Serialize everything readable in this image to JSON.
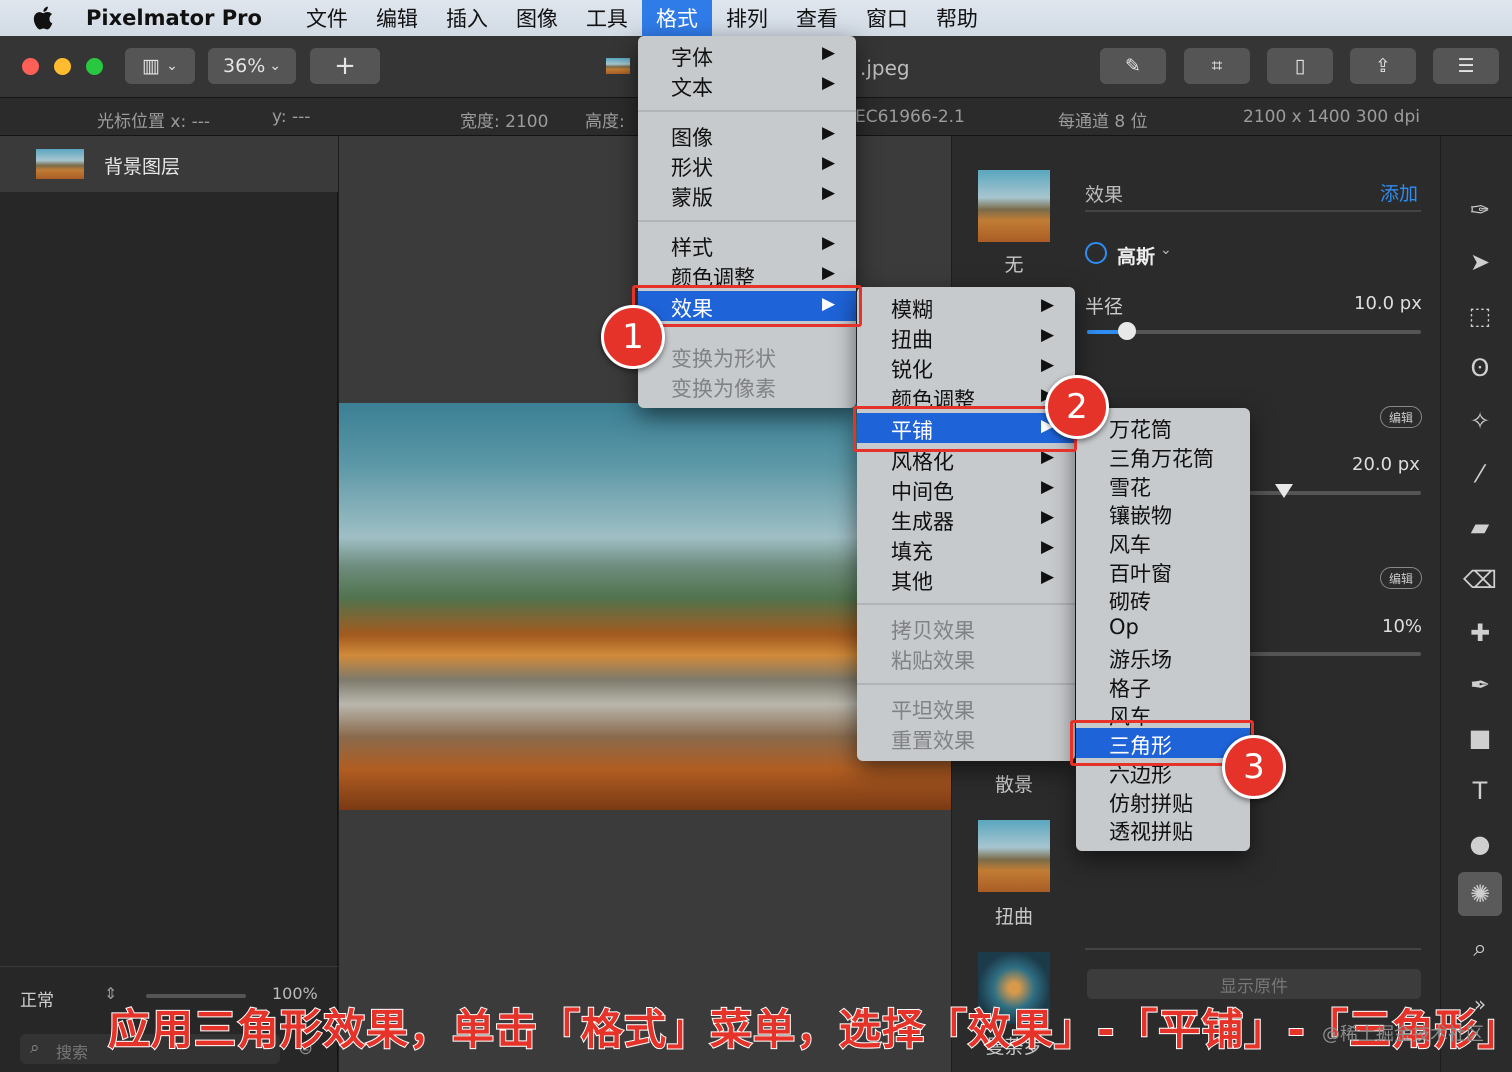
{
  "menubar": {
    "app_name": "Pixelmator Pro",
    "items": [
      "文件",
      "编辑",
      "插入",
      "图像",
      "工具",
      "格式",
      "排列",
      "查看",
      "窗口",
      "帮助"
    ],
    "active": "格式"
  },
  "toolbar": {
    "zoom": "36%",
    "add": "+",
    "doc_title": ".jpeg"
  },
  "infobar": {
    "cursor_x": "光标位置 x: ---",
    "cursor_y": "y: ---",
    "width": "宽度: 2100",
    "height": "高度:",
    "profile": "EC61966-2.1",
    "depth": "每通道 8 位",
    "size": "2100 x 1400 300 dpi"
  },
  "layers": {
    "layer_name": "背景图层",
    "blend_mode": "正常",
    "opacity": "100%",
    "search_placeholder": "搜索"
  },
  "effects_panel": {
    "title": "效果",
    "add": "添加",
    "effect_name": "高斯",
    "radius_label": "半径",
    "radius_value": "10.0 px",
    "value2": "20.0 px",
    "value3": "10%",
    "edit": "编辑",
    "show_original": "显示原件",
    "thumbs": [
      "无",
      "散景",
      "扭曲",
      "曼荼罗"
    ]
  },
  "format_menu": {
    "items": [
      "字体",
      "文本",
      "图像",
      "形状",
      "蒙版",
      "样式",
      "颜色调整",
      "效果",
      "变换为形状",
      "变换为像素"
    ]
  },
  "effects_menu": {
    "items": [
      "模糊",
      "扭曲",
      "锐化",
      "颜色调整",
      "平铺",
      "风格化",
      "中间色",
      "生成器",
      "填充",
      "其他",
      "拷贝效果",
      "粘贴效果",
      "平坦效果",
      "重置效果"
    ]
  },
  "tile_menu": {
    "items": [
      "万花筒",
      "三角万花筒",
      "雪花",
      "镶嵌物",
      "风车",
      "百叶窗",
      "砌砖",
      "Op",
      "游乐场",
      "格子",
      "风车",
      "三角形",
      "六边形",
      "仿射拼贴",
      "透视拼贴"
    ]
  },
  "annotations": {
    "step1": "1",
    "step2": "2",
    "step3": "3",
    "caption": "应用三角形效果，单击「格式」菜单，选择「效果」-「平铺」-「三角形」",
    "watermark": "@稀土掘金技术社区"
  },
  "colors": {
    "accent": "#1e63d8",
    "highlight": "#e5332a",
    "link": "#2f8cf0"
  }
}
